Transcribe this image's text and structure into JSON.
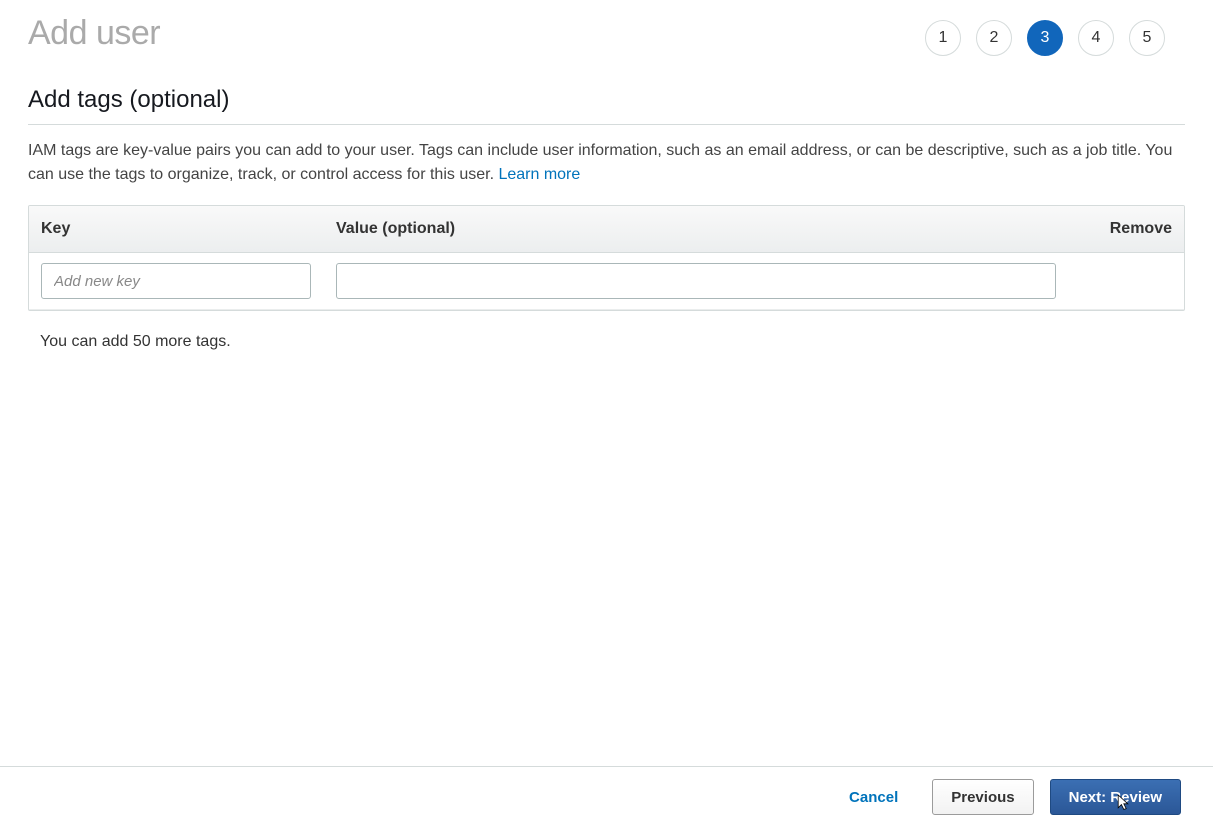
{
  "header": {
    "title": "Add user",
    "steps": [
      "1",
      "2",
      "3",
      "4",
      "5"
    ],
    "active_step_index": 2
  },
  "section": {
    "title": "Add tags (optional)",
    "description": "IAM tags are key-value pairs you can add to your user. Tags can include user information, such as an email address, or can be descriptive, such as a job title. You can use the tags to organize, track, or control access for this user. ",
    "learn_more": "Learn more"
  },
  "table": {
    "headers": {
      "key": "Key",
      "value": "Value (optional)",
      "remove": "Remove"
    },
    "row": {
      "key_placeholder": "Add new key",
      "value_placeholder": ""
    },
    "note": "You can add 50 more tags."
  },
  "footer": {
    "cancel": "Cancel",
    "previous": "Previous",
    "next": "Next: Review"
  }
}
